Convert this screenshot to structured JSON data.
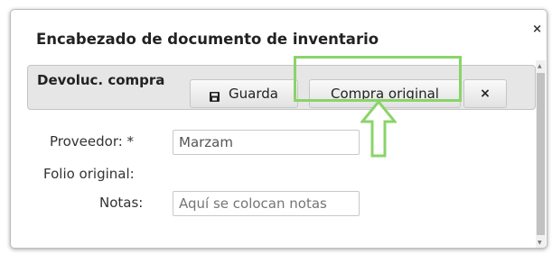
{
  "dialog": {
    "title": "Encabezado de documento de inventario",
    "close_glyph": "×"
  },
  "toolbar": {
    "title": "Devoluc. compra",
    "save_label": "Guarda",
    "save_icon": "floppy-disk-icon",
    "original_purchase_label": "Compra original",
    "close_glyph": "×"
  },
  "form": {
    "supplier": {
      "label": "Proveedor: *",
      "value": "Marzam"
    },
    "original_folio": {
      "label": "Folio original:"
    },
    "notes": {
      "label": "Notas:",
      "placeholder": "Aquí se colocan notas"
    }
  },
  "annotation": {
    "highlight_color": "#8ad46a",
    "arrow_color": "#8ad46a",
    "arrow_icon": "up-arrow-icon"
  }
}
